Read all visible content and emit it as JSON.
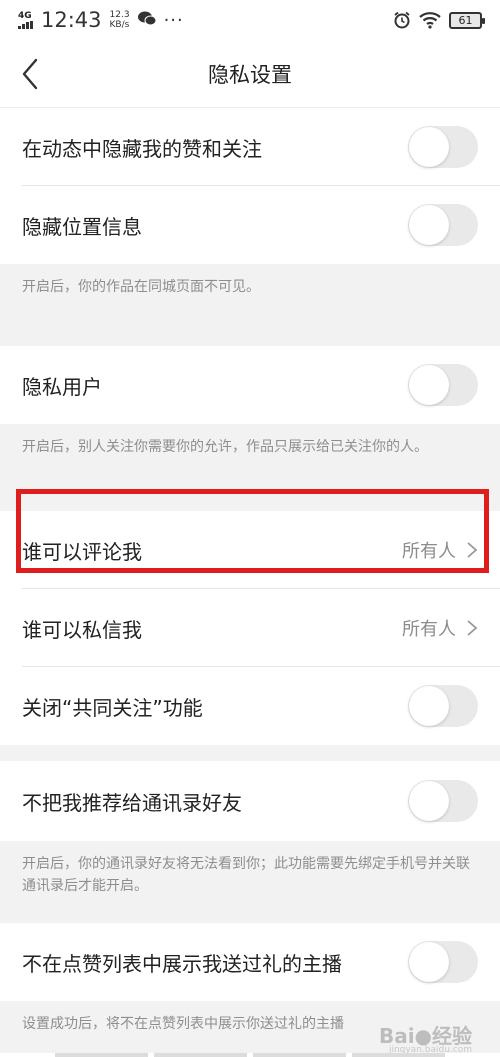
{
  "status_bar": {
    "network": "4G",
    "time": "12:43",
    "speed_value": "12.3",
    "speed_unit": "KB/s",
    "more": "···",
    "battery": "61"
  },
  "nav": {
    "title": "隐私设置"
  },
  "settings": {
    "hide_likes": {
      "label": "在动态中隐藏我的赞和关注",
      "on": false
    },
    "hide_location": {
      "label": "隐藏位置信息",
      "on": false
    },
    "hide_location_note": "开启后，你的作品在同城页面不可见。",
    "private_user": {
      "label": "隐私用户",
      "on": false
    },
    "private_user_note": "开启后，别人关注你需要你的允许，作品只展示给已关注你的人。",
    "who_can_comment": {
      "label": "谁可以评论我",
      "value": "所有人"
    },
    "who_can_message": {
      "label": "谁可以私信我",
      "value": "所有人"
    },
    "close_mutual_follow": {
      "label": "关闭“共同关注”功能",
      "on": false
    },
    "no_contacts_recommend": {
      "label": "不把我推荐给通讯录好友",
      "on": false
    },
    "no_contacts_recommend_note": "开启后，你的通讯录好友将无法看到你；此功能需要先绑定手机号并关联通讯录后才能开启。",
    "hide_gifted_streamers": {
      "label": "不在点赞列表中展示我送过礼的主播",
      "on": false
    },
    "hide_gifted_streamers_note": "设置成功后，将不在点赞列表中展示你送过礼的主播"
  },
  "watermark": {
    "brand": "Bai●经验",
    "site": "jingyan.baidu.com"
  },
  "colors": {
    "highlight": "#e01d1d",
    "toggle_off": "#e9e9e9",
    "background": "#f2f2f2"
  }
}
